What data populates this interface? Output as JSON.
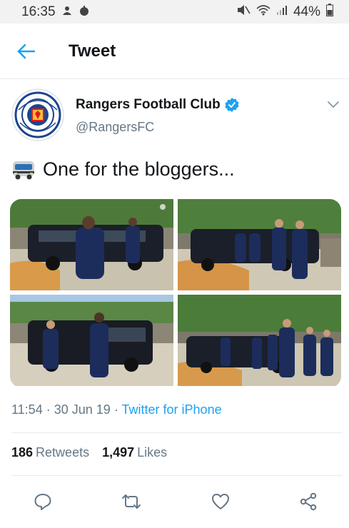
{
  "status_bar": {
    "time": "16:35",
    "battery": "44%",
    "icons": [
      "notification-icon",
      "alarm-icon",
      "mute-icon",
      "wifi-icon",
      "signal-icon",
      "battery-icon"
    ]
  },
  "header": {
    "title": "Tweet",
    "back_icon": "back-arrow-icon"
  },
  "tweet": {
    "author": {
      "display_name": "Rangers Football Club",
      "handle": "@RangersFC",
      "verified": true
    },
    "text": "One for the bloggers...",
    "emoji_icon": "bus-emoji-icon",
    "media_count": 4,
    "time": "11:54",
    "separator": "·",
    "date": "30 Jun 19",
    "source": "Twitter for iPhone",
    "retweets": {
      "count": "186",
      "label": "Retweets"
    },
    "likes": {
      "count": "1,497",
      "label": "Likes"
    }
  },
  "actions": [
    "reply-icon",
    "retweet-icon",
    "like-icon",
    "share-icon"
  ],
  "colors": {
    "accent": "#1da1f2",
    "secondary_text": "#657786",
    "primary_text": "#14171a",
    "divider": "#e6ecf0",
    "rangers_blue": "#1b458f",
    "rangers_red": "#e01b22"
  }
}
